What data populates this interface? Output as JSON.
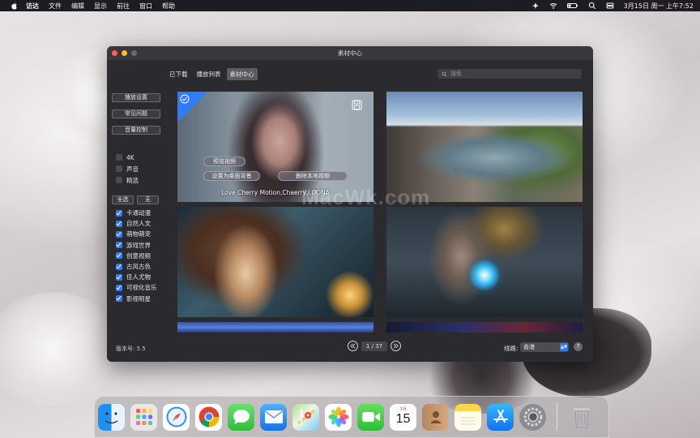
{
  "menubar": {
    "items": [
      "访达",
      "文件",
      "编辑",
      "显示",
      "前往",
      "窗口",
      "帮助"
    ],
    "datetime": "3月15日 周一 上午7:52"
  },
  "window": {
    "title": "素材中心",
    "tabs": [
      {
        "label": "已下载",
        "active": false
      },
      {
        "label": "播放列表",
        "active": false
      },
      {
        "label": "素材中心",
        "active": true
      }
    ],
    "search_placeholder": "搜索"
  },
  "sidebar": {
    "buttons": [
      "播放设置",
      "常见问题",
      "音量控制"
    ],
    "options": [
      {
        "label": "4K",
        "checked": false
      },
      {
        "label": "声音",
        "checked": false
      },
      {
        "label": "精选",
        "checked": false
      }
    ],
    "select_all": "全选",
    "select_none": "无",
    "categories": [
      {
        "label": "卡通动漫",
        "checked": true
      },
      {
        "label": "自然人文",
        "checked": true
      },
      {
        "label": "萌物萌宠",
        "checked": true
      },
      {
        "label": "游戏世界",
        "checked": true
      },
      {
        "label": "创意视频",
        "checked": true
      },
      {
        "label": "古风古色",
        "checked": true
      },
      {
        "label": "佳人尤物",
        "checked": true
      },
      {
        "label": "可视化音乐",
        "checked": true
      },
      {
        "label": "影视明星",
        "checked": true
      }
    ]
  },
  "grid": {
    "selected_tile": {
      "caption": "Love Cherry Motion,Chaerry,LOONA",
      "preview_label": "预览视频",
      "set_bg_label": "设置为桌面背景",
      "remove_label": "删除本地视频"
    }
  },
  "footer": {
    "version": "版本号: 5.5",
    "page": "1 / 37",
    "line_label": "线路:",
    "line_value": "香港",
    "help": "?"
  },
  "watermark": "MacWk.com",
  "dock": {
    "calendar_month": "3月",
    "calendar_day": "15",
    "apps": [
      "finder-icon",
      "launchpad-icon",
      "safari-icon",
      "chrome-icon",
      "messages-icon",
      "mail-icon",
      "maps-icon",
      "photos-icon",
      "facetime-icon",
      "calendar-icon",
      "contacts-icon",
      "notes-icon",
      "app-store-icon",
      "system-preferences-icon",
      "trash-icon"
    ]
  },
  "colors": {
    "accent": "#2f7cf6",
    "window_bg": "#2b2b2f",
    "menubar_bg": "#1d1c22"
  }
}
